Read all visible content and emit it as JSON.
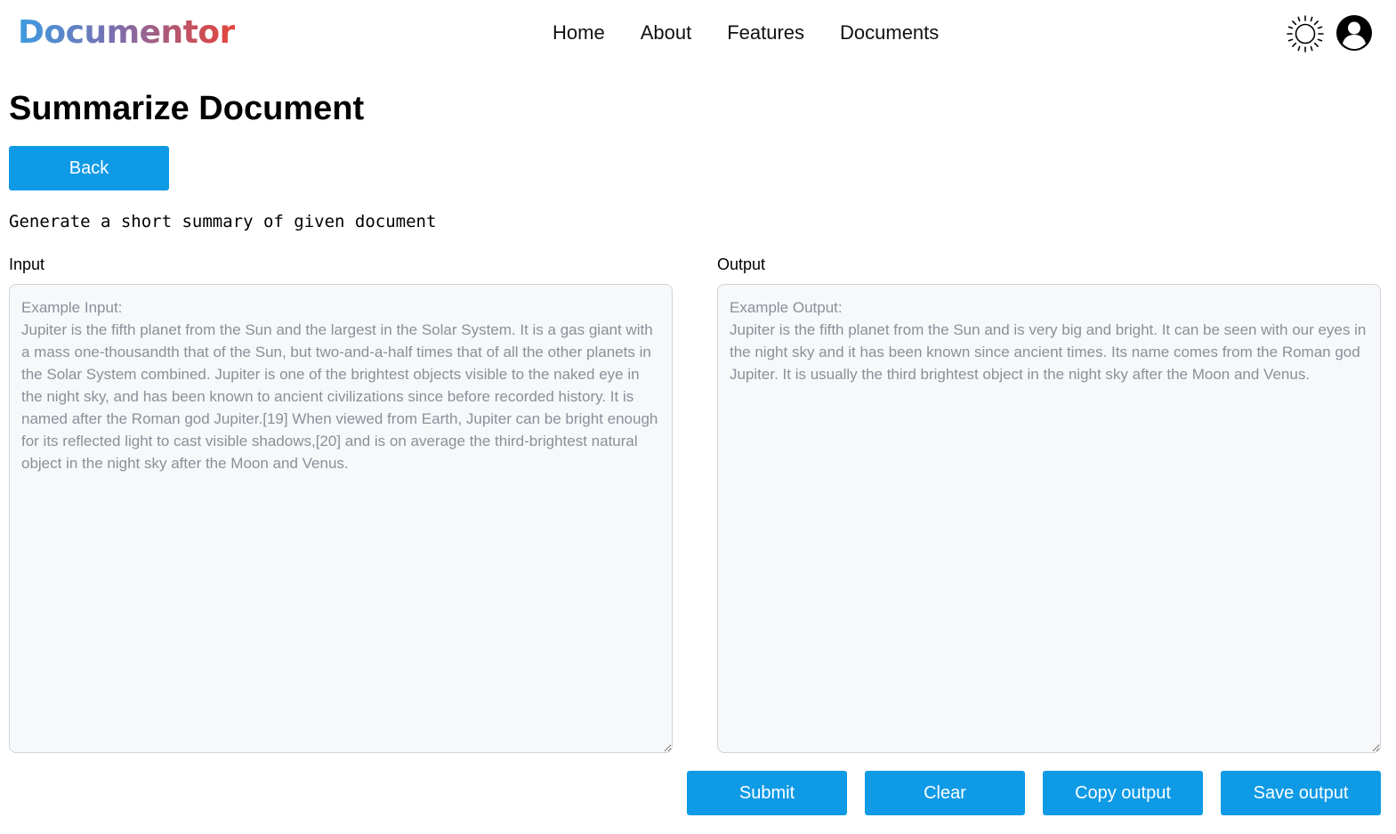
{
  "brand": {
    "name": "Documentor"
  },
  "nav": {
    "items": [
      {
        "label": "Home"
      },
      {
        "label": "About"
      },
      {
        "label": "Features"
      },
      {
        "label": "Documents"
      }
    ]
  },
  "header_icons": {
    "theme": "sun-icon",
    "account": "user-avatar-icon"
  },
  "page": {
    "title": "Summarize Document",
    "back_label": "Back",
    "description": "Generate a short summary of given document"
  },
  "input": {
    "label": "Input",
    "value": "",
    "placeholder": "Example Input:\nJupiter is the fifth planet from the Sun and the largest in the Solar System. It is a gas giant with a mass one-thousandth that of the Sun, but two-and-a-half times that of all the other planets in the Solar System combined. Jupiter is one of the brightest objects visible to the naked eye in the night sky, and has been known to ancient civilizations since before recorded history. It is named after the Roman god Jupiter.[19] When viewed from Earth, Jupiter can be bright enough for its reflected light to cast visible shadows,[20] and is on average the third-brightest natural object in the night sky after the Moon and Venus."
  },
  "output": {
    "label": "Output",
    "value": "",
    "placeholder": "Example Output:\nJupiter is the fifth planet from the Sun and is very big and bright. It can be seen with our eyes in the night sky and it has been known since ancient times. Its name comes from the Roman god Jupiter. It is usually the third brightest object in the night sky after the Moon and Venus."
  },
  "actions": {
    "submit": "Submit",
    "clear": "Clear",
    "copy": "Copy output",
    "save": "Save output"
  },
  "colors": {
    "primary_button": "#0f9ae6",
    "panel_background": "#f7f8fa",
    "placeholder_text": "#8a9099"
  }
}
